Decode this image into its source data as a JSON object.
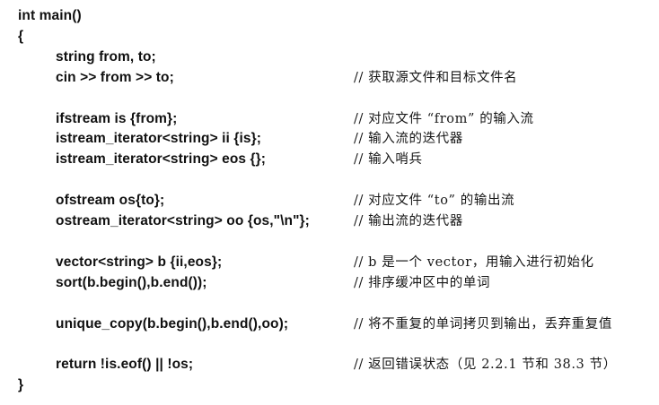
{
  "code": {
    "lines": [
      {
        "level": 0,
        "text": "int main()",
        "comment": ""
      },
      {
        "level": 0,
        "text": "{",
        "comment": ""
      },
      {
        "level": 1,
        "text": "string from, to;",
        "comment": ""
      },
      {
        "level": 1,
        "text": "cin >> from >> to;",
        "comment": "// 获取源文件和目标文件名"
      },
      {
        "level": 1,
        "text": "",
        "comment": ""
      },
      {
        "level": 1,
        "text": "ifstream is {from};",
        "comment": "// 对应文件 “from” 的输入流"
      },
      {
        "level": 1,
        "text": "istream_iterator<string> ii {is};",
        "comment": "// 输入流的迭代器"
      },
      {
        "level": 1,
        "text": "istream_iterator<string> eos {};",
        "comment": "// 输入哨兵"
      },
      {
        "level": 1,
        "text": "",
        "comment": ""
      },
      {
        "level": 1,
        "text": "ofstream os{to};",
        "comment": "// 对应文件 “to” 的输出流"
      },
      {
        "level": 1,
        "text": "ostream_iterator<string> oo {os,\"\\n\"};",
        "comment": "// 输出流的迭代器"
      },
      {
        "level": 1,
        "text": "",
        "comment": ""
      },
      {
        "level": 1,
        "text": "vector<string> b {ii,eos};",
        "comment": "// b 是一个 vector，用输入进行初始化"
      },
      {
        "level": 1,
        "text": "sort(b.begin(),b.end());",
        "comment": "// 排序缓冲区中的单词"
      },
      {
        "level": 1,
        "text": "",
        "comment": ""
      },
      {
        "level": 1,
        "text": "unique_copy(b.begin(),b.end(),oo);",
        "comment": "// 将不重复的单词拷贝到输出，丢弃重复值"
      },
      {
        "level": 1,
        "text": "",
        "comment": ""
      },
      {
        "level": 1,
        "text": "return !is.eof() || !os;",
        "comment": "// 返回错误状态（见 2.2.1 节和 38.3 节）"
      },
      {
        "level": 0,
        "text": "}",
        "comment": ""
      }
    ]
  }
}
